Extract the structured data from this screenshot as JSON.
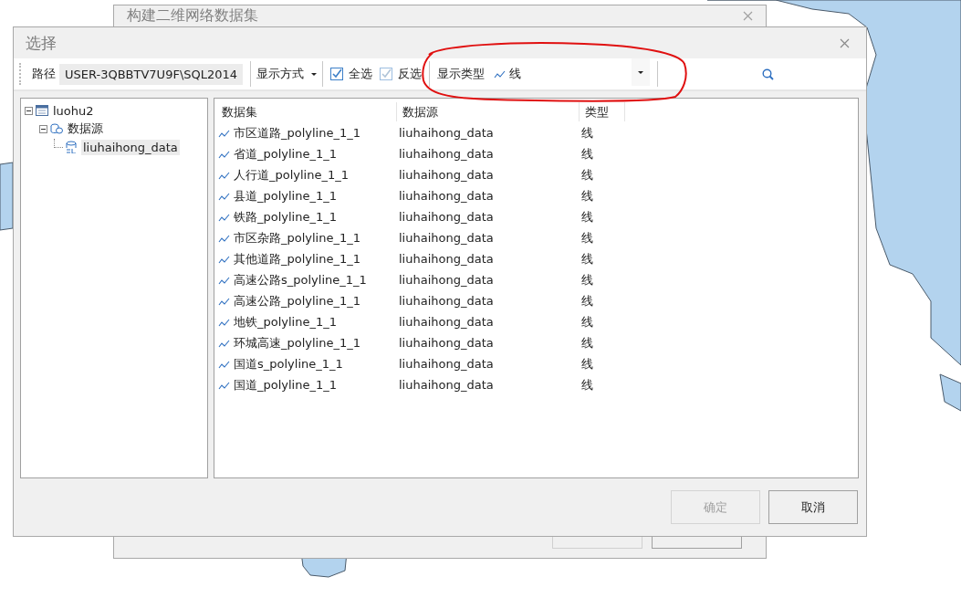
{
  "background_window": {
    "title": "构建二维网络数据集"
  },
  "dialog": {
    "title": "选择",
    "toolbar": {
      "path_label": "路径",
      "path_value": "USER-3QBBTV7U9F\\SQL2014",
      "display_mode": "显示方式",
      "select_all": {
        "label": "全选",
        "checked": true
      },
      "invert": {
        "label": "反选",
        "checked": true
      },
      "type_label": "显示类型",
      "type_value": "线"
    },
    "tree": [
      {
        "label": "luohu2",
        "expanded": true,
        "selected": false,
        "children": [
          {
            "label": "数据源",
            "expanded": true,
            "selected": false,
            "children": [
              {
                "label": "liuhaihong_data",
                "selected": true
              }
            ]
          }
        ]
      }
    ],
    "table": {
      "columns": [
        "数据集",
        "数据源",
        "类型"
      ],
      "rows": [
        [
          "市区道路_polyline_1_1",
          "liuhaihong_data",
          "线"
        ],
        [
          "省道_polyline_1_1",
          "liuhaihong_data",
          "线"
        ],
        [
          "人行道_polyline_1_1",
          "liuhaihong_data",
          "线"
        ],
        [
          "县道_polyline_1_1",
          "liuhaihong_data",
          "线"
        ],
        [
          "铁路_polyline_1_1",
          "liuhaihong_data",
          "线"
        ],
        [
          "市区杂路_polyline_1_1",
          "liuhaihong_data",
          "线"
        ],
        [
          "其他道路_polyline_1_1",
          "liuhaihong_data",
          "线"
        ],
        [
          "高速公路s_polyline_1_1",
          "liuhaihong_data",
          "线"
        ],
        [
          "高速公路_polyline_1_1",
          "liuhaihong_data",
          "线"
        ],
        [
          "地铁_polyline_1_1",
          "liuhaihong_data",
          "线"
        ],
        [
          "环城高速_polyline_1_1",
          "liuhaihong_data",
          "线"
        ],
        [
          "国道s_polyline_1_1",
          "liuhaihong_data",
          "线"
        ],
        [
          "国道_polyline_1_1",
          "liuhaihong_data",
          "线"
        ]
      ]
    },
    "buttons": [
      {
        "label": "确定",
        "disabled": true
      },
      {
        "label": "取消",
        "disabled": false
      }
    ]
  }
}
